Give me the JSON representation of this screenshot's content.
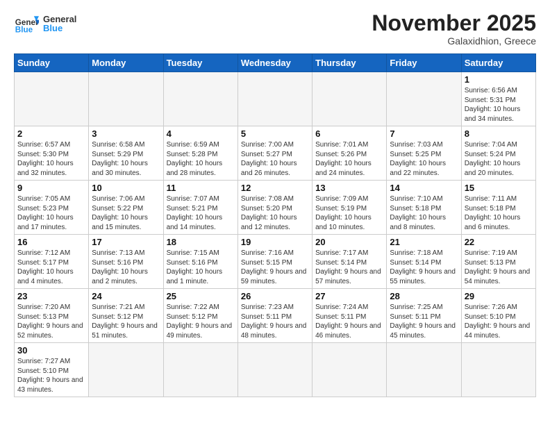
{
  "header": {
    "logo_general": "General",
    "logo_blue": "Blue",
    "month_title": "November 2025",
    "subtitle": "Galaxidhion, Greece"
  },
  "days_of_week": [
    "Sunday",
    "Monday",
    "Tuesday",
    "Wednesday",
    "Thursday",
    "Friday",
    "Saturday"
  ],
  "weeks": [
    [
      {
        "day": "",
        "info": ""
      },
      {
        "day": "",
        "info": ""
      },
      {
        "day": "",
        "info": ""
      },
      {
        "day": "",
        "info": ""
      },
      {
        "day": "",
        "info": ""
      },
      {
        "day": "",
        "info": ""
      },
      {
        "day": "1",
        "info": "Sunrise: 6:56 AM\nSunset: 5:31 PM\nDaylight: 10 hours\nand 34 minutes."
      }
    ],
    [
      {
        "day": "2",
        "info": "Sunrise: 6:57 AM\nSunset: 5:30 PM\nDaylight: 10 hours\nand 32 minutes."
      },
      {
        "day": "3",
        "info": "Sunrise: 6:58 AM\nSunset: 5:29 PM\nDaylight: 10 hours\nand 30 minutes."
      },
      {
        "day": "4",
        "info": "Sunrise: 6:59 AM\nSunset: 5:28 PM\nDaylight: 10 hours\nand 28 minutes."
      },
      {
        "day": "5",
        "info": "Sunrise: 7:00 AM\nSunset: 5:27 PM\nDaylight: 10 hours\nand 26 minutes."
      },
      {
        "day": "6",
        "info": "Sunrise: 7:01 AM\nSunset: 5:26 PM\nDaylight: 10 hours\nand 24 minutes."
      },
      {
        "day": "7",
        "info": "Sunrise: 7:03 AM\nSunset: 5:25 PM\nDaylight: 10 hours\nand 22 minutes."
      },
      {
        "day": "8",
        "info": "Sunrise: 7:04 AM\nSunset: 5:24 PM\nDaylight: 10 hours\nand 20 minutes."
      }
    ],
    [
      {
        "day": "9",
        "info": "Sunrise: 7:05 AM\nSunset: 5:23 PM\nDaylight: 10 hours\nand 17 minutes."
      },
      {
        "day": "10",
        "info": "Sunrise: 7:06 AM\nSunset: 5:22 PM\nDaylight: 10 hours\nand 15 minutes."
      },
      {
        "day": "11",
        "info": "Sunrise: 7:07 AM\nSunset: 5:21 PM\nDaylight: 10 hours\nand 14 minutes."
      },
      {
        "day": "12",
        "info": "Sunrise: 7:08 AM\nSunset: 5:20 PM\nDaylight: 10 hours\nand 12 minutes."
      },
      {
        "day": "13",
        "info": "Sunrise: 7:09 AM\nSunset: 5:19 PM\nDaylight: 10 hours\nand 10 minutes."
      },
      {
        "day": "14",
        "info": "Sunrise: 7:10 AM\nSunset: 5:18 PM\nDaylight: 10 hours\nand 8 minutes."
      },
      {
        "day": "15",
        "info": "Sunrise: 7:11 AM\nSunset: 5:18 PM\nDaylight: 10 hours\nand 6 minutes."
      }
    ],
    [
      {
        "day": "16",
        "info": "Sunrise: 7:12 AM\nSunset: 5:17 PM\nDaylight: 10 hours\nand 4 minutes."
      },
      {
        "day": "17",
        "info": "Sunrise: 7:13 AM\nSunset: 5:16 PM\nDaylight: 10 hours\nand 2 minutes."
      },
      {
        "day": "18",
        "info": "Sunrise: 7:15 AM\nSunset: 5:16 PM\nDaylight: 10 hours\nand 1 minute."
      },
      {
        "day": "19",
        "info": "Sunrise: 7:16 AM\nSunset: 5:15 PM\nDaylight: 9 hours\nand 59 minutes."
      },
      {
        "day": "20",
        "info": "Sunrise: 7:17 AM\nSunset: 5:14 PM\nDaylight: 9 hours\nand 57 minutes."
      },
      {
        "day": "21",
        "info": "Sunrise: 7:18 AM\nSunset: 5:14 PM\nDaylight: 9 hours\nand 55 minutes."
      },
      {
        "day": "22",
        "info": "Sunrise: 7:19 AM\nSunset: 5:13 PM\nDaylight: 9 hours\nand 54 minutes."
      }
    ],
    [
      {
        "day": "23",
        "info": "Sunrise: 7:20 AM\nSunset: 5:13 PM\nDaylight: 9 hours\nand 52 minutes."
      },
      {
        "day": "24",
        "info": "Sunrise: 7:21 AM\nSunset: 5:12 PM\nDaylight: 9 hours\nand 51 minutes."
      },
      {
        "day": "25",
        "info": "Sunrise: 7:22 AM\nSunset: 5:12 PM\nDaylight: 9 hours\nand 49 minutes."
      },
      {
        "day": "26",
        "info": "Sunrise: 7:23 AM\nSunset: 5:11 PM\nDaylight: 9 hours\nand 48 minutes."
      },
      {
        "day": "27",
        "info": "Sunrise: 7:24 AM\nSunset: 5:11 PM\nDaylight: 9 hours\nand 46 minutes."
      },
      {
        "day": "28",
        "info": "Sunrise: 7:25 AM\nSunset: 5:11 PM\nDaylight: 9 hours\nand 45 minutes."
      },
      {
        "day": "29",
        "info": "Sunrise: 7:26 AM\nSunset: 5:10 PM\nDaylight: 9 hours\nand 44 minutes."
      }
    ],
    [
      {
        "day": "30",
        "info": "Sunrise: 7:27 AM\nSunset: 5:10 PM\nDaylight: 9 hours\nand 43 minutes."
      },
      {
        "day": "",
        "info": ""
      },
      {
        "day": "",
        "info": ""
      },
      {
        "day": "",
        "info": ""
      },
      {
        "day": "",
        "info": ""
      },
      {
        "day": "",
        "info": ""
      },
      {
        "day": "",
        "info": ""
      }
    ]
  ]
}
